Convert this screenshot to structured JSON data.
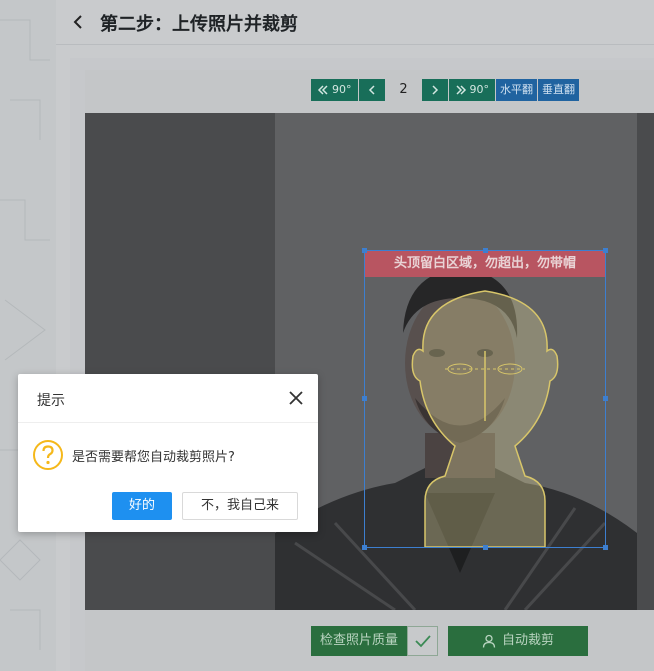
{
  "header": {
    "title": "第二步：上传照片并裁剪"
  },
  "toolbar": {
    "rotate_left_label": "90°",
    "page_number": "2",
    "rotate_right_label": "90°",
    "flip_horizontal_label": "水平翻",
    "flip_vertical_label": "垂直翻"
  },
  "crop": {
    "banner_text": "头顶留白区域，勿超出，勿带帽"
  },
  "bottom": {
    "check_quality_label": "检查照片质量",
    "auto_crop_label": "自动裁剪"
  },
  "dialog": {
    "title": "提示",
    "message": "是否需要帮您自动裁剪照片?",
    "ok_label": "好的",
    "no_label": "不，我自己来"
  },
  "colors": {
    "teal_button": "#186e59",
    "blue_button": "#2063a0",
    "green_button": "#2a6e3e",
    "dialog_primary": "#1e90f0",
    "question_icon": "#f5b81a",
    "crop_border": "#3d7fd0",
    "banner": "#b85561"
  }
}
